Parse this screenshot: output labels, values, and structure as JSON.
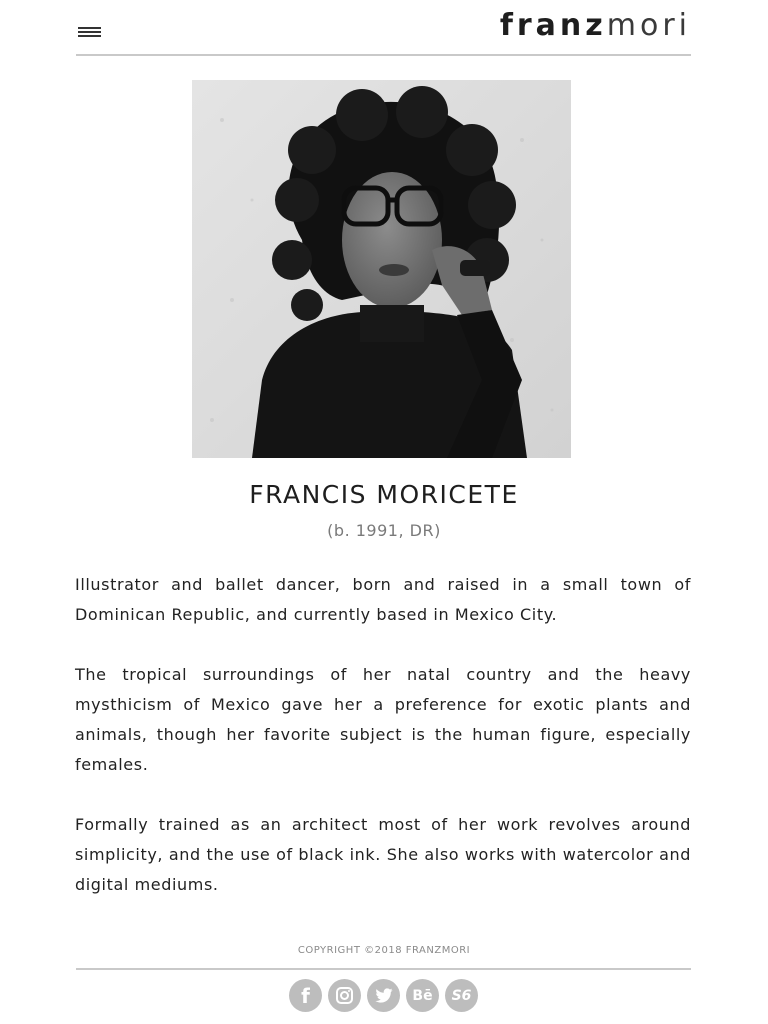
{
  "header": {
    "logo_bold": "franz",
    "logo_light": "mori",
    "menu_icon": "hamburger-menu-icon"
  },
  "profile": {
    "photo_alt": "FRANCIS MORICETE",
    "name": "FRANCIS MORICETE",
    "meta": "(b. 1991, DR)"
  },
  "bio": {
    "paragraphs": [
      "Illustrator and ballet dancer, born and raised in a small town of Dominican Republic, and currently based in Mexico City.",
      "The tropical surroundings of her natal country and the heavy mysthicism of Mexico gave her a preference for exotic plants and animals, though her favorite subject is the human figure, especially  females.",
      "Formally trained as an architect most of her work revolves around simplicity, and the use of black ink. She also works with watercolor and digital mediums."
    ]
  },
  "footer": {
    "copyright": "COPYRIGHT ©2018 FRANZMORI",
    "socials": [
      {
        "name": "facebook",
        "icon": "facebook-icon",
        "glyph": "f"
      },
      {
        "name": "instagram",
        "icon": "instagram-icon",
        "glyph": ""
      },
      {
        "name": "twitter",
        "icon": "twitter-icon",
        "glyph": ""
      },
      {
        "name": "behance",
        "icon": "behance-icon",
        "glyph": "Bē"
      },
      {
        "name": "society6",
        "icon": "society6-icon",
        "glyph": "S6"
      }
    ]
  },
  "colors": {
    "text": "#222222",
    "muted": "#7a7a7a",
    "rule": "#c9c9c9",
    "social_bg": "#bdbdbd"
  }
}
